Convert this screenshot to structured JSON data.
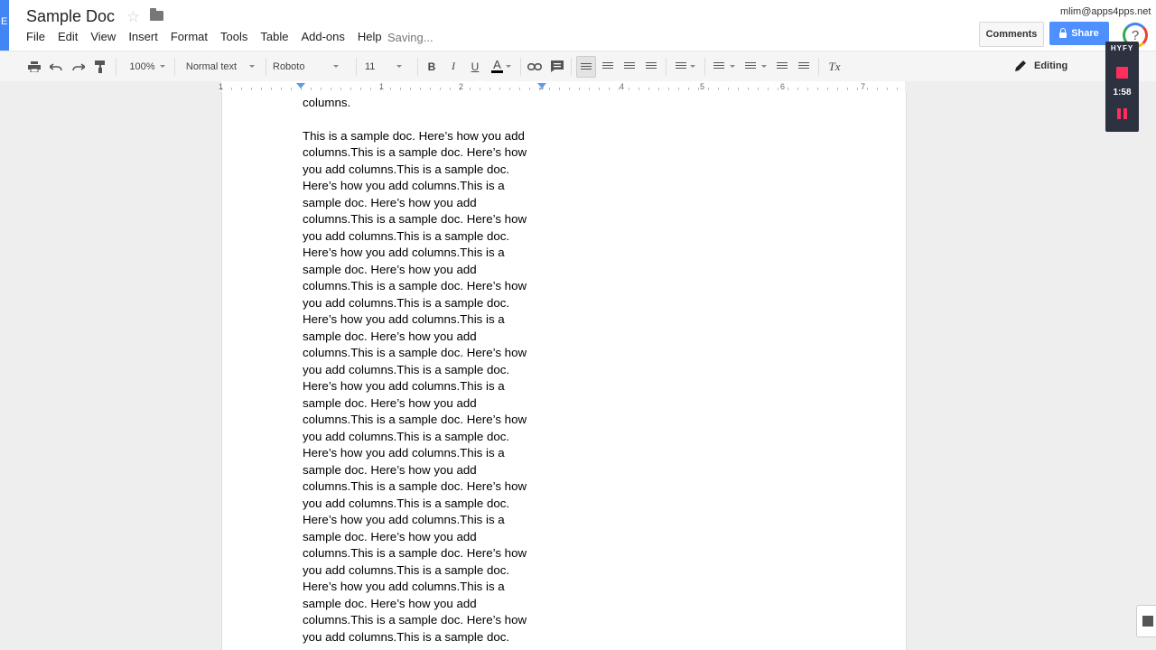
{
  "app": {
    "title": "Sample Doc",
    "saving_status": "Saving...",
    "user_email": "mlim@apps4pps.net",
    "brand_letter": "E"
  },
  "menu": [
    "File",
    "Edit",
    "View",
    "Insert",
    "Format",
    "Tools",
    "Table",
    "Add-ons",
    "Help"
  ],
  "buttons": {
    "comments": "Comments",
    "share": "Share",
    "help": "?"
  },
  "toolbar": {
    "zoom": "100%",
    "style": "Normal text",
    "font": "Roboto",
    "size": "11",
    "bold": "B",
    "italic": "I",
    "underline": "U",
    "text_color": "A",
    "clear": "Tx",
    "mode": "Editing"
  },
  "ruler": {
    "numbers": [
      "1",
      "1",
      "2",
      "3",
      "4",
      "5",
      "6",
      "7"
    ]
  },
  "document": {
    "para1_fragment": "columns.",
    "para2_lines": [
      "This is a sample doc. Here’s how you add",
      "columns.This is a sample doc. Here’s how",
      "you add columns.This is a sample doc.",
      "Here’s how you add columns.This is a",
      "sample doc. Here’s how you add",
      "columns.This is a sample doc. Here’s how",
      "you add columns.This is a sample doc.",
      "Here’s how you add columns.This is a",
      "sample doc. Here’s how you add",
      "columns.This is a sample doc. Here’s how",
      "you add columns.This is a sample doc.",
      "Here’s how you add columns.This is a",
      "sample doc. Here’s how you add",
      "columns.This is a sample doc. Here’s how",
      "you add columns.This is a sample doc.",
      "Here’s how you add columns.This is a",
      "sample doc. Here’s how you add",
      "columns.This is a sample doc. Here’s how",
      "you add columns.This is a sample doc.",
      "Here’s how you add columns.This is a",
      "sample doc. Here’s how you add",
      "columns.This is a sample doc. Here’s how",
      "you add columns.This is a sample doc.",
      "Here’s how you add columns.This is a",
      "sample doc. Here’s how you add",
      "columns.This is a sample doc. Here’s how",
      "you add columns.This is a sample doc.",
      "Here’s how you add columns.This is a",
      "sample doc. Here’s how you add",
      "columns.This is a sample doc. Here’s how",
      "you add columns.This is a sample doc."
    ]
  },
  "recorder": {
    "title": "HYFY",
    "time": "1:58"
  },
  "colors": {
    "accent": "#4d90fe",
    "record": "#ff2e5c",
    "recorder_bg": "#2d3240"
  }
}
